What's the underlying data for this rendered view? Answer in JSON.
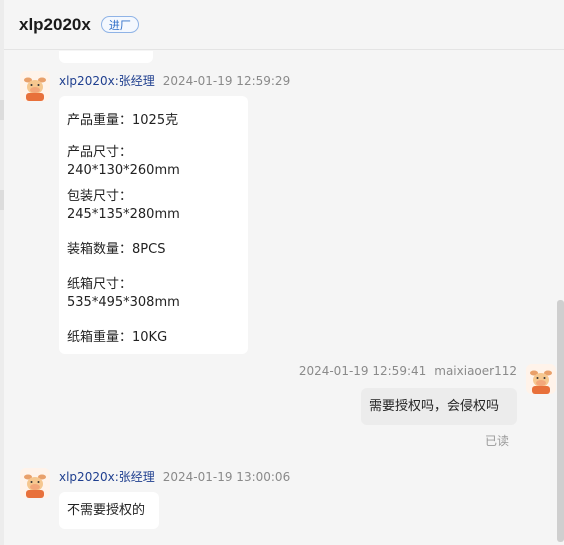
{
  "header": {
    "title": "xlp2020x",
    "tag": "进厂"
  },
  "messages": [
    {
      "sender": "xlp2020x:张经理",
      "time": "2024-01-19 12:59:29",
      "lines": [
        "产品重量：1025克",
        "产品尺寸：240*130*260mm",
        "包装尺寸：245*135*280mm",
        "装箱数量：8PCS",
        "纸箱尺寸：535*495*308mm",
        "纸箱重量：10KG"
      ]
    },
    {
      "sender": "maixiaoer112",
      "time": "2024-01-19 12:59:41",
      "text": "需要授权吗，会侵权吗",
      "status": "已读"
    },
    {
      "sender": "xlp2020x:张经理",
      "time": "2024-01-19 13:00:06",
      "text": "不需要授权的"
    }
  ],
  "colors": {
    "sender_link": "#1f3f8f",
    "tag_border": "#8fb3e6",
    "background": "#f5f5f5",
    "outgoing_bubble": "#ececec",
    "incoming_bubble": "#ffffff"
  },
  "icons": {
    "avatar": "cartoon-cow-avatar-icon"
  }
}
